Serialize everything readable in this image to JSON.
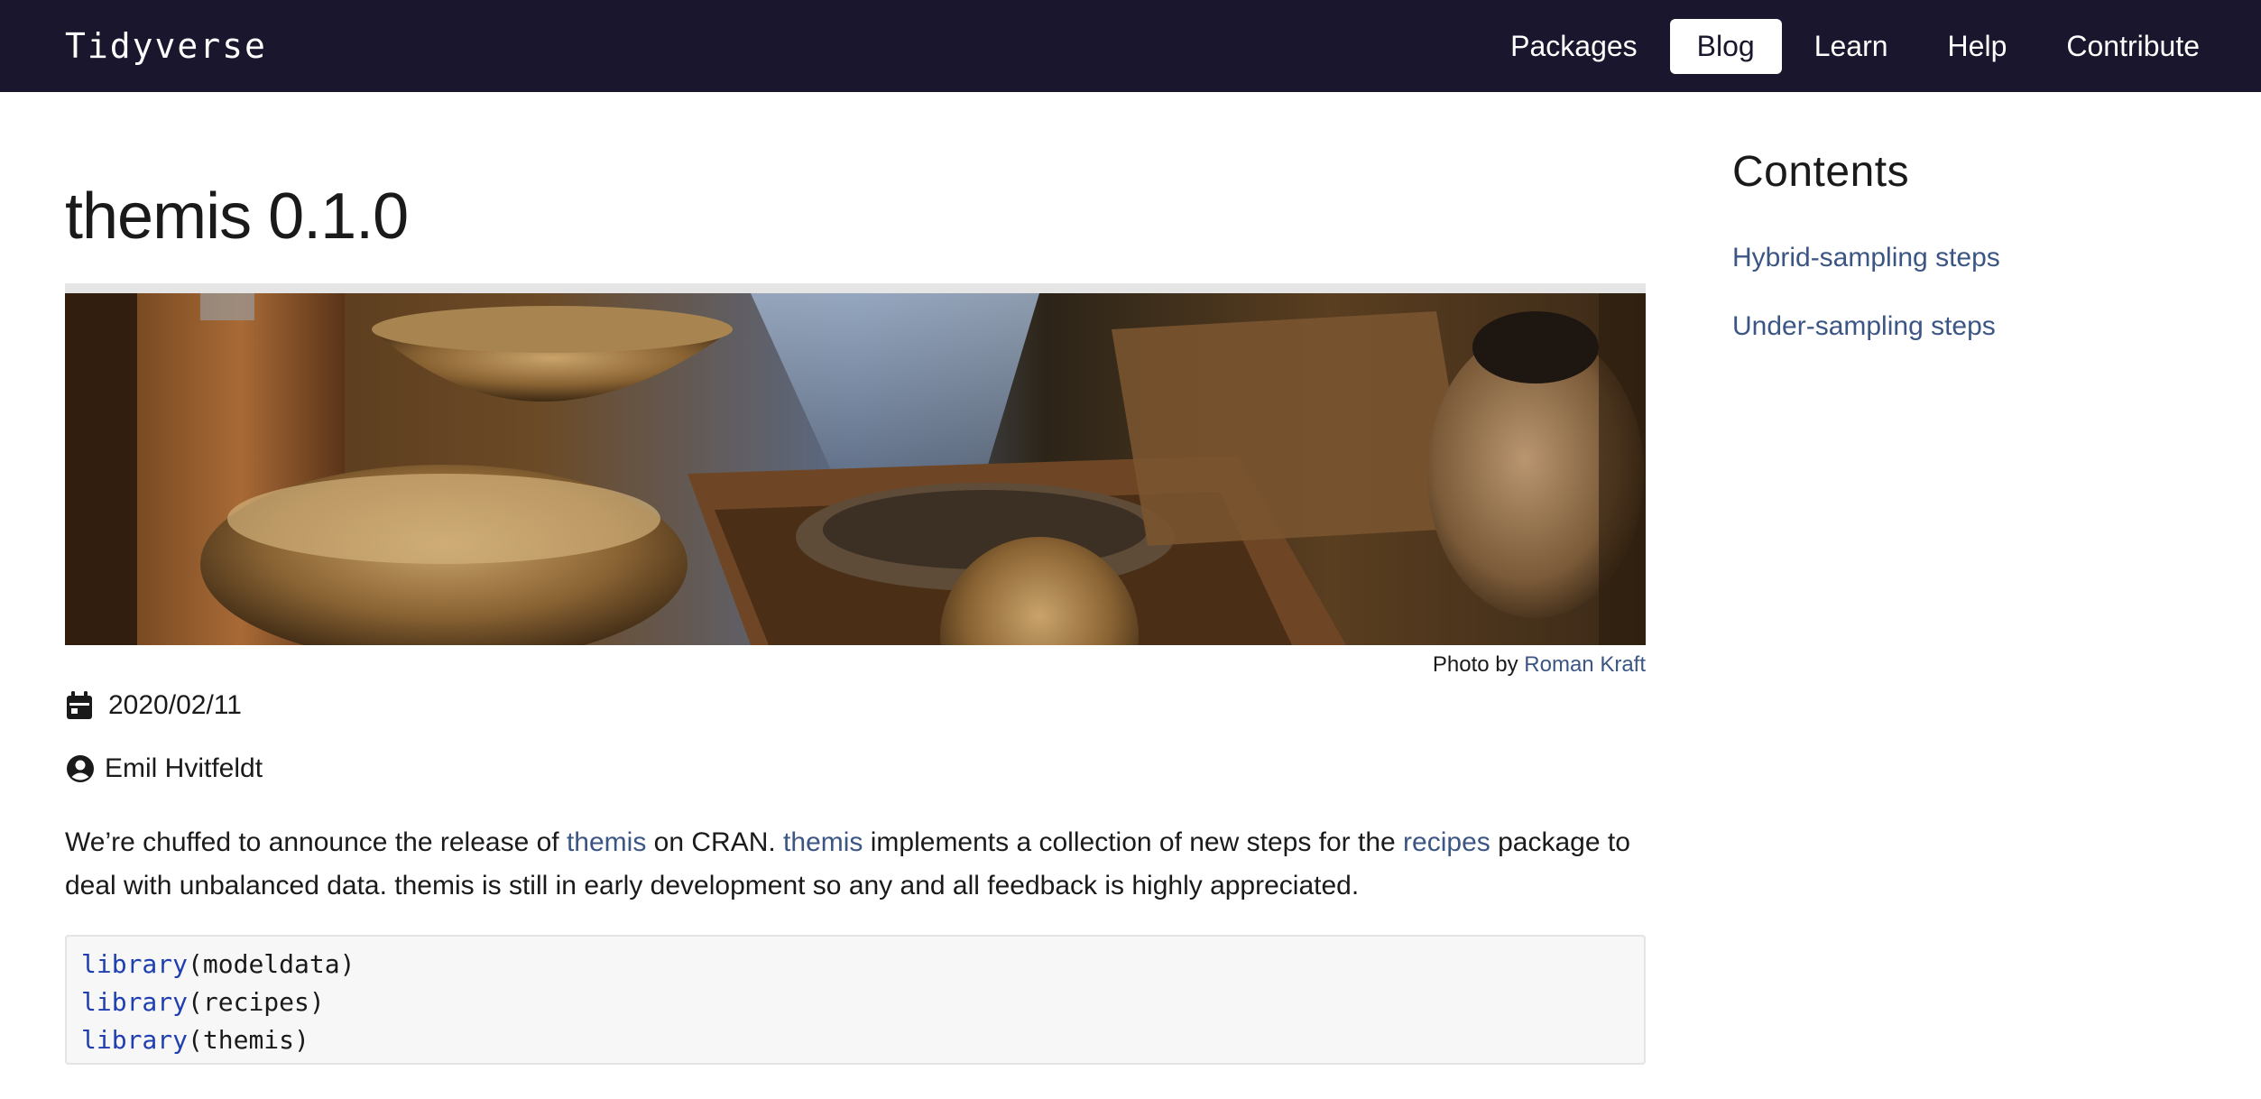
{
  "nav": {
    "brand": "Tidyverse",
    "items": [
      {
        "label": "Packages",
        "active": false
      },
      {
        "label": "Blog",
        "active": true
      },
      {
        "label": "Learn",
        "active": false
      },
      {
        "label": "Help",
        "active": false
      },
      {
        "label": "Contribute",
        "active": false
      }
    ]
  },
  "post": {
    "title": "themis 0.1.0",
    "hero_image": "photo of wooden bowls, baskets and a stoneware jug",
    "caption_prefix": "Photo by",
    "caption_author": "Roman Kraft",
    "date": "2020/02/11",
    "author": "Emil Hvitfeldt",
    "intro": {
      "p1": "We’re chuffed to announce the release of",
      "link1": "themis",
      "p2": "on CRAN.",
      "link2": "themis",
      "p3": "implements a collection of new steps for the",
      "link3": "recipes",
      "p4": "package to deal with unbalanced data. themis is still in early development so any and all feedback is highly appreciated."
    },
    "code": [
      {
        "fn": "library",
        "arg": "(modeldata)"
      },
      {
        "fn": "library",
        "arg": "(recipes)"
      },
      {
        "fn": "library",
        "arg": "(themis)"
      }
    ]
  },
  "toc": {
    "title": "Contents",
    "items": [
      "Hybrid-sampling steps",
      "Under-sampling steps"
    ]
  },
  "colors": {
    "navbar_bg": "#1a162d",
    "link": "#3b5684",
    "code_keyword": "#1f3fb0",
    "code_bg": "#f7f7f7"
  },
  "icons": {
    "date": "calendar-icon",
    "author": "user-circle-icon"
  }
}
